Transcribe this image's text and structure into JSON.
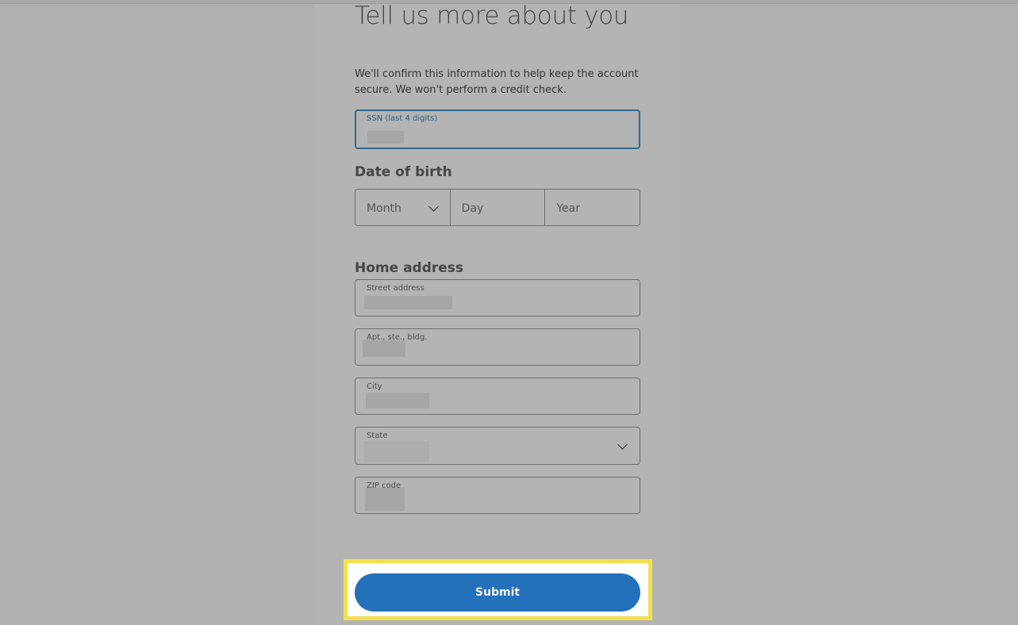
{
  "form": {
    "title": "Tell us more about you",
    "intro": "We'll confirm this information to help keep the account secure. We won't perform a credit check.",
    "ssn": {
      "label": "SSN (last 4 digits)",
      "value_redacted": true
    },
    "dob": {
      "heading": "Date of birth",
      "month_placeholder": "Month",
      "day_placeholder": "Day",
      "year_placeholder": "Year"
    },
    "address": {
      "heading": "Home address",
      "street": {
        "label": "Street address",
        "value_redacted": true
      },
      "apt": {
        "label": "Apt., ste., bldg.",
        "value_redacted": true
      },
      "city": {
        "label": "City",
        "value_redacted": true
      },
      "state": {
        "label": "State",
        "value_redacted": true
      },
      "zip": {
        "label": "ZIP code",
        "value_redacted": true
      }
    },
    "submit_label": "Submit"
  },
  "colors": {
    "primary_button": "#2371bb",
    "focus_border": "#2f6a90",
    "highlight_frame": "#f4e04d"
  }
}
